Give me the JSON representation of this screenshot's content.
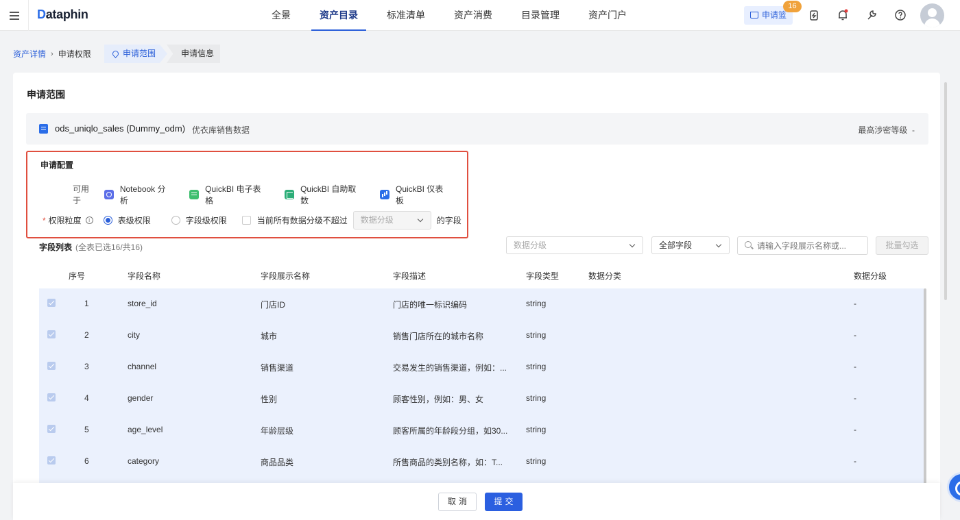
{
  "nav": {
    "logo_prefix": "D",
    "logo_rest": "ataphin",
    "menu": [
      "全景",
      "资产目录",
      "标准清单",
      "资产消费",
      "目录管理",
      "资产门户"
    ],
    "active_index": 1,
    "cart_label": "申请篮",
    "cart_count": "16"
  },
  "breadcrumb": {
    "link": "资产详情",
    "separator": "›",
    "current": "申请权限",
    "step1": "申请范围",
    "step2": "申请信息"
  },
  "section_title": "申请范围",
  "table_info": {
    "name": "ods_uniqlo_sales (Dummy_odm)",
    "description": "优衣库销售数据",
    "max_level_label": "最高涉密等级",
    "max_level_value": "-"
  },
  "config": {
    "title": "申请配置",
    "usable_label": "可用于",
    "tools": [
      "Notebook 分析",
      "QuickBI 电子表格",
      "QuickBI 自助取数",
      "QuickBI 仪表板"
    ],
    "required_mark": "*",
    "granularity_label": "权限粒度",
    "info_icon_text": "i",
    "option_table": "表级权限",
    "option_field": "字段级权限",
    "option_field_selected": false,
    "option_table_selected": true,
    "checkbox_label": "当前所有数据分级不超过",
    "level_placeholder": "数据分级",
    "suffix": "的字段"
  },
  "field_list": {
    "title": "字段列表",
    "count": "(全表已选16/共16)",
    "filter_level_placeholder": "数据分级",
    "filter_fields_value": "全部字段",
    "search_placeholder": "请输入字段展示名称或...",
    "batch_button": "批量勾选",
    "columns": [
      "序号",
      "字段名称",
      "字段展示名称",
      "字段描述",
      "字段类型",
      "数据分类",
      "数据分级"
    ],
    "rows": [
      {
        "no": "1",
        "name": "store_id",
        "display": "门店ID",
        "desc": "门店的唯一标识编码",
        "type": "string",
        "category": "",
        "level": "-"
      },
      {
        "no": "2",
        "name": "city",
        "display": "城市",
        "desc": "销售门店所在的城市名称",
        "type": "string",
        "category": "",
        "level": "-"
      },
      {
        "no": "3",
        "name": "channel",
        "display": "销售渠道",
        "desc": "交易发生的销售渠道，例如：...",
        "type": "string",
        "category": "",
        "level": "-"
      },
      {
        "no": "4",
        "name": "gender",
        "display": "性别",
        "desc": "顾客性别，例如：男、女",
        "type": "string",
        "category": "",
        "level": "-"
      },
      {
        "no": "5",
        "name": "age_level",
        "display": "年龄层级",
        "desc": "顾客所属的年龄段分组，如30...",
        "type": "string",
        "category": "",
        "level": "-"
      },
      {
        "no": "6",
        "name": "category",
        "display": "商品品类",
        "desc": "所售商品的类别名称，如：T...",
        "type": "string",
        "category": "",
        "level": "-"
      }
    ]
  },
  "footer": {
    "cancel": "取消",
    "submit": "提交"
  },
  "colors": {
    "accent": "#2b5fd9",
    "highlight_border": "#e04f3f",
    "selected_row_bg": "#ebf1fd",
    "badge": "#f0a23b"
  }
}
